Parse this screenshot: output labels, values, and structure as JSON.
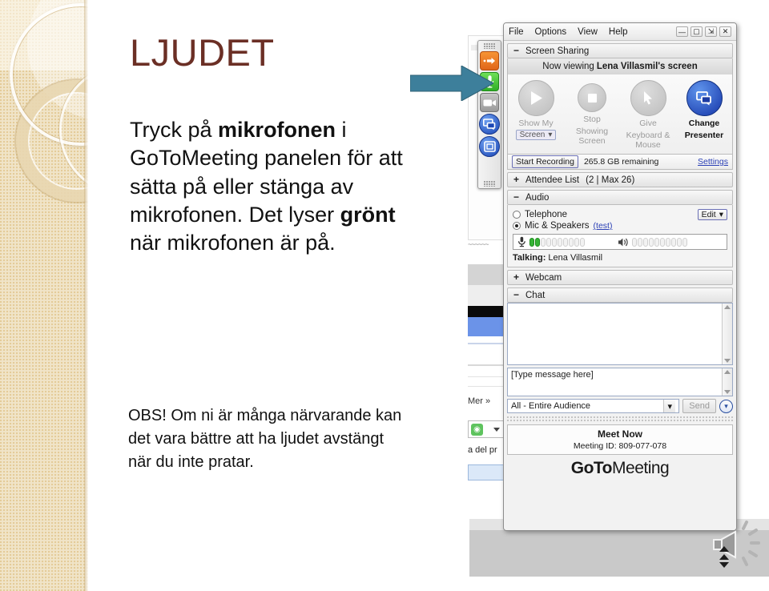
{
  "slide": {
    "title": "LJUDET",
    "body_html": "Tryck på <b>mikrofonen</b> i GoToMeeting panelen för att sätta på eller stänga av mikrofonen. Det lyser <b>grönt</b> när mikrofonen är på.",
    "note": "OBS! Om ni är många närvarande kan det vara bättre att ha ljudet avstängt när du inte pratar.",
    "title_color": "#6b2f25",
    "arrow_color": "#3d7f9b"
  },
  "toolbar": {
    "buttons": [
      {
        "name": "show-hide-control-panel",
        "icon": "arrow-right-icon",
        "color": "#e0661a"
      },
      {
        "name": "mic-toggle",
        "icon": "microphone-icon",
        "color": "#2fae26"
      },
      {
        "name": "webcam-toggle",
        "icon": "webcam-icon",
        "color": "#9a9a9a"
      },
      {
        "name": "change-presenter",
        "icon": "screen-share-icon",
        "color": "#1b47b5"
      },
      {
        "name": "view-window",
        "icon": "window-icon",
        "color": "#1b47b5"
      }
    ]
  },
  "gtm": {
    "menu": [
      "File",
      "Options",
      "View",
      "Help"
    ],
    "window_controls": [
      "minimize",
      "maximize",
      "restore",
      "close"
    ],
    "screen_sharing": {
      "section_label": "Screen Sharing",
      "collapse_glyph": "−",
      "now_viewing_prefix": "Now viewing",
      "now_viewing_name": "Lena Villasmil's screen",
      "controls": [
        {
          "label": "Show My",
          "sub": "",
          "dropdown": "Screen",
          "state": "disabled",
          "icon": "play-icon"
        },
        {
          "label": "Stop",
          "sub": "Showing Screen",
          "state": "disabled",
          "icon": "stop-icon"
        },
        {
          "label": "Give",
          "sub": "Keyboard & Mouse",
          "state": "disabled",
          "icon": "cursor-icon"
        },
        {
          "label": "Change",
          "sub": "Presenter",
          "state": "active",
          "icon": "screen-share-icon"
        }
      ],
      "record_button": "Start Recording",
      "record_status": "265.8 GB remaining",
      "settings_link": "Settings"
    },
    "attendee": {
      "label": "Attendee List",
      "count": "(2 | Max 26)",
      "expand_glyph": "+"
    },
    "audio": {
      "label": "Audio",
      "collapse_glyph": "−",
      "telephone_label": "Telephone",
      "mic_speakers_label": "Mic & Speakers",
      "test_link": "(test)",
      "edit_button": "Edit",
      "selected": "mic_speakers",
      "mic_level": 2,
      "mic_pips": 10,
      "speaker_level": 0,
      "speaker_pips": 10,
      "talking_label": "Talking:",
      "talking_name": "Lena Villasmil"
    },
    "webcam": {
      "label": "Webcam",
      "expand_glyph": "+"
    },
    "chat": {
      "label": "Chat",
      "collapse_glyph": "−",
      "transcript": "",
      "message_placeholder": "[Type message here]",
      "audience": "All - Entire Audience",
      "send_button": "Send"
    },
    "footer": {
      "meet_now": "Meet Now",
      "meeting_id_label": "Meeting ID: 809-077-078",
      "logo_bold": "GoTo",
      "logo_light": "Meeting"
    }
  },
  "background": {
    "mer_text": "Mer »",
    "del_text": "a del pr"
  }
}
